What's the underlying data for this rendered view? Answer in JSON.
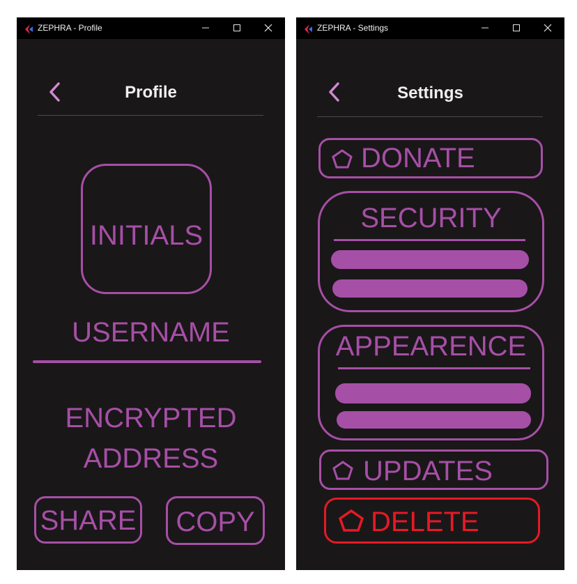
{
  "profile_window": {
    "title": "ZEPHRA - Profile",
    "header": {
      "title": "Profile"
    },
    "avatar_text": "INITIALS",
    "username": "USERNAME",
    "address_line1": "ENCRYPTED",
    "address_line2": "ADDRESS",
    "share_label": "SHARE",
    "copy_label": "COPY"
  },
  "settings_window": {
    "title": "ZEPHRA - Settings",
    "header": {
      "title": "Settings"
    },
    "donate_label": "DONATE",
    "security_label": "SECURITY",
    "appearance_label": "APPEARENCE",
    "updates_label": "UPDATES",
    "delete_label": "DELETE"
  },
  "colors": {
    "accent": "#a64fa6",
    "danger": "#e51a24",
    "window_bg": "#1a1719",
    "titlebar_bg": "#000000",
    "text_light": "#efefef"
  },
  "icons": {
    "back": "chevron-left-icon",
    "option": "pentagon-icon",
    "minimize": "minimize-icon",
    "maximize": "maximize-icon",
    "close": "close-icon"
  }
}
